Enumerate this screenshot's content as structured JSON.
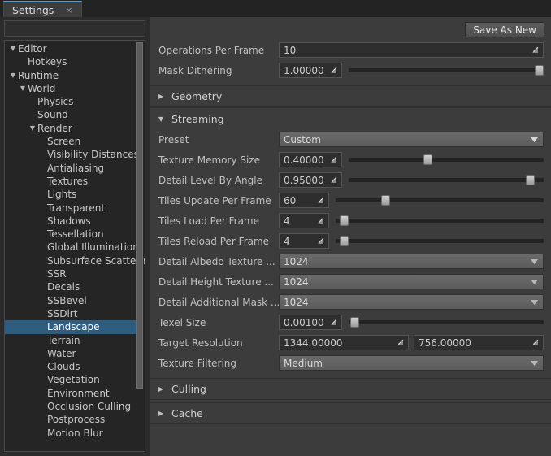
{
  "window": {
    "tab_label": "Settings",
    "tab_close_glyph": "×"
  },
  "sidebar": {
    "search_placeholder": "",
    "search_value": "",
    "items": [
      {
        "label": "Editor",
        "indent": 0,
        "caret": "down",
        "selected": false
      },
      {
        "label": "Hotkeys",
        "indent": 1,
        "caret": "none",
        "selected": false
      },
      {
        "label": "Runtime",
        "indent": 0,
        "caret": "down",
        "selected": false
      },
      {
        "label": "World",
        "indent": 1,
        "caret": "down",
        "selected": false
      },
      {
        "label": "Physics",
        "indent": 2,
        "caret": "none",
        "selected": false
      },
      {
        "label": "Sound",
        "indent": 2,
        "caret": "none",
        "selected": false
      },
      {
        "label": "Render",
        "indent": 2,
        "caret": "down",
        "selected": false
      },
      {
        "label": "Screen",
        "indent": 3,
        "caret": "none",
        "selected": false
      },
      {
        "label": "Visibility Distances",
        "indent": 3,
        "caret": "none",
        "selected": false
      },
      {
        "label": "Antialiasing",
        "indent": 3,
        "caret": "none",
        "selected": false
      },
      {
        "label": "Textures",
        "indent": 3,
        "caret": "none",
        "selected": false
      },
      {
        "label": "Lights",
        "indent": 3,
        "caret": "none",
        "selected": false
      },
      {
        "label": "Transparent",
        "indent": 3,
        "caret": "none",
        "selected": false
      },
      {
        "label": "Shadows",
        "indent": 3,
        "caret": "none",
        "selected": false
      },
      {
        "label": "Tessellation",
        "indent": 3,
        "caret": "none",
        "selected": false
      },
      {
        "label": "Global Illumination",
        "indent": 3,
        "caret": "none",
        "selected": false
      },
      {
        "label": "Subsurface Scattering",
        "indent": 3,
        "caret": "none",
        "selected": false
      },
      {
        "label": "SSR",
        "indent": 3,
        "caret": "none",
        "selected": false
      },
      {
        "label": "Decals",
        "indent": 3,
        "caret": "none",
        "selected": false
      },
      {
        "label": "SSBevel",
        "indent": 3,
        "caret": "none",
        "selected": false
      },
      {
        "label": "SSDirt",
        "indent": 3,
        "caret": "none",
        "selected": false
      },
      {
        "label": "Landscape",
        "indent": 3,
        "caret": "none",
        "selected": true
      },
      {
        "label": "Terrain",
        "indent": 3,
        "caret": "none",
        "selected": false
      },
      {
        "label": "Water",
        "indent": 3,
        "caret": "none",
        "selected": false
      },
      {
        "label": "Clouds",
        "indent": 3,
        "caret": "none",
        "selected": false
      },
      {
        "label": "Vegetation",
        "indent": 3,
        "caret": "none",
        "selected": false
      },
      {
        "label": "Environment",
        "indent": 3,
        "caret": "none",
        "selected": false
      },
      {
        "label": "Occlusion Culling",
        "indent": 3,
        "caret": "none",
        "selected": false
      },
      {
        "label": "Postprocess",
        "indent": 3,
        "caret": "none",
        "selected": false
      },
      {
        "label": "Motion Blur",
        "indent": 3,
        "caret": "none",
        "selected": false
      }
    ]
  },
  "main": {
    "save_as_new_label": "Save As New",
    "top_rows": [
      {
        "label": "Operations Per Frame",
        "value": "10"
      },
      {
        "label": "Mask Dithering",
        "value": "1.00000",
        "slider_pct": 100
      }
    ],
    "sections": [
      {
        "label": "Geometry",
        "expanded": false
      },
      {
        "label": "Streaming",
        "expanded": true
      },
      {
        "label": "Culling",
        "expanded": false
      },
      {
        "label": "Cache",
        "expanded": false
      }
    ],
    "streaming": {
      "preset_label": "Preset",
      "preset_value": "Custom",
      "rows": [
        {
          "label": "Texture Memory Size",
          "value": "0.40000",
          "slider_pct": 40
        },
        {
          "label": "Detail Level By Angle",
          "value": "0.95000",
          "slider_pct": 95
        },
        {
          "label": "Tiles Update Per Frame",
          "value": "60",
          "slider_pct": 23
        },
        {
          "label": "Tiles Load Per Frame",
          "value": "4",
          "slider_pct": 2
        },
        {
          "label": "Tiles Reload Per Frame",
          "value": "4",
          "slider_pct": 2
        }
      ],
      "combos": [
        {
          "label": "Detail Albedo Texture ...",
          "value": "1024"
        },
        {
          "label": "Detail Height Texture ...",
          "value": "1024"
        },
        {
          "label": "Detail Additional Mask ...",
          "value": "1024"
        }
      ],
      "texel_size": {
        "label": "Texel Size",
        "value": "0.00100",
        "slider_pct": 1
      },
      "target_resolution": {
        "label": "Target Resolution",
        "value_x": "1344.00000",
        "value_y": "756.00000"
      },
      "texture_filtering": {
        "label": "Texture Filtering",
        "value": "Medium"
      }
    }
  },
  "icons": {
    "caret_down": "▼",
    "caret_right": "▶",
    "spinner": "resize-arrow-icon"
  },
  "colors": {
    "accent_tab": "#4f9fd0",
    "selection": "#2f5d80",
    "panel_bg": "#3c3c3c",
    "tree_bg": "#252525",
    "field_bg": "#2e2e2e"
  }
}
